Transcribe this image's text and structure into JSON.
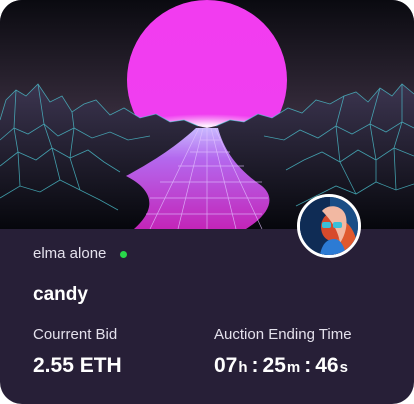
{
  "card": {
    "owner": "elma alone",
    "title": "candy",
    "bid_label": "Courrent Bid",
    "bid_value": "2.55 ETH",
    "time_label": "Auction Ending Time",
    "countdown": {
      "hours": "07",
      "hours_unit": "h",
      "minutes": "25",
      "minutes_unit": "m",
      "seconds": "46",
      "seconds_unit": "s",
      "separator": ":"
    }
  },
  "colors": {
    "card_background": "#271f37",
    "online_status": "#29d84a",
    "sun": "#f432f4",
    "grid_lines": "#4ec9d6"
  },
  "icons": {
    "online": "online-status-dot"
  }
}
